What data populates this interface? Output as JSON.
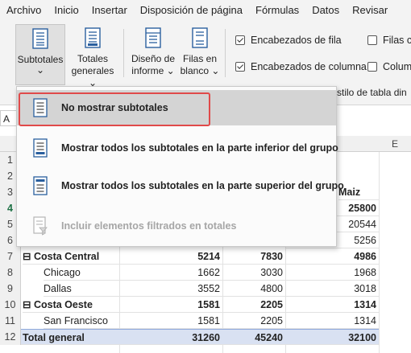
{
  "menu": [
    "Archivo",
    "Inicio",
    "Insertar",
    "Disposición de página",
    "Fórmulas",
    "Datos",
    "Revisar"
  ],
  "ribbon": {
    "subtotales": {
      "label": "Subtotales",
      "caret": "⌄",
      "icon": "table-subtotal-icon"
    },
    "totales_generales": {
      "line1": "Totales",
      "line2": "generales ⌄",
      "icon": "table-grand-totals-icon"
    },
    "diseno_informe": {
      "line1": "Diseño de",
      "line2": "informe ⌄",
      "icon": "table-report-layout-icon"
    },
    "filas_blanco": {
      "line1": "Filas en",
      "line2": "blanco ⌄",
      "icon": "table-blank-rows-icon"
    },
    "options": [
      {
        "label": "Encabezados de fila",
        "checked": true
      },
      {
        "label": "Encabezados de columna",
        "checked": true
      },
      {
        "label": "Filas co",
        "checked": false
      },
      {
        "label": "Colum",
        "checked": false
      }
    ],
    "style_group_label": "stilo de tabla din"
  },
  "dropdown": {
    "items": [
      {
        "label": "No mostrar subtotales",
        "icon": "no-subtotals-icon",
        "highlighted": true,
        "disabled": false
      },
      {
        "label": "Mostrar todos los subtotales en la parte inferior del grupo",
        "icon": "subtotals-bottom-icon",
        "highlighted": false,
        "disabled": false
      },
      {
        "label": "Mostrar todos los subtotales en la parte superior del grupo",
        "icon": "subtotals-top-icon",
        "highlighted": false,
        "disabled": false
      },
      {
        "label": "Incluir elementos filtrados en totales",
        "icon": "filtered-totals-icon",
        "highlighted": false,
        "disabled": true
      }
    ]
  },
  "sheet": {
    "namebox": "A",
    "col_header_e": "E",
    "row_numbers": [
      "1",
      "2",
      "3",
      "4",
      "5",
      "6",
      "7",
      "8",
      "9",
      "10",
      "11",
      "12"
    ],
    "header_maiz": "Maiz",
    "peek_values": {
      "r4": "25800",
      "r5": "20544",
      "r6": "5256"
    },
    "rows": [
      {
        "label": "Costa Central",
        "v1": "5214",
        "v2": "7830",
        "v3": "4986",
        "type": "group"
      },
      {
        "label": "Chicago",
        "v1": "1662",
        "v2": "3030",
        "v3": "1968",
        "type": "item"
      },
      {
        "label": "Dallas",
        "v1": "3552",
        "v2": "4800",
        "v3": "3018",
        "type": "item"
      },
      {
        "label": "Costa Oeste",
        "v1": "1581",
        "v2": "2205",
        "v3": "1314",
        "type": "group"
      },
      {
        "label": "San Francisco",
        "v1": "1581",
        "v2": "2205",
        "v3": "1314",
        "type": "item"
      },
      {
        "label": "Total general",
        "v1": "31260",
        "v2": "45240",
        "v3": "32100",
        "type": "grand"
      }
    ],
    "collapse_glyph": "⊟"
  },
  "colors": {
    "accent_highlight": "#e04a4a",
    "grand_total_fill": "#d9e1f2",
    "selected_row": "#1e7145"
  }
}
